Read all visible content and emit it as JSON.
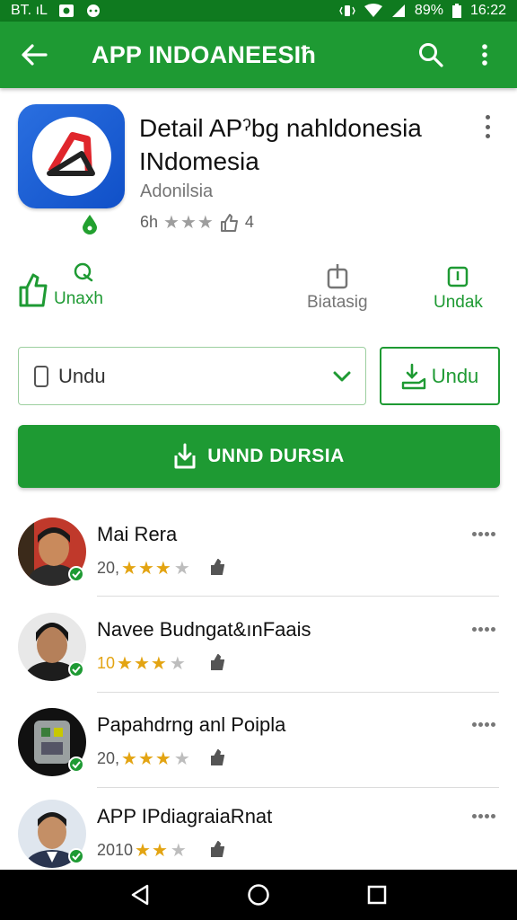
{
  "status_bar": {
    "carrier": "BT. ıL",
    "battery": "89%",
    "time": "16:22"
  },
  "app_bar": {
    "title": "APP INDOANEESIħ"
  },
  "app": {
    "title": "Detail APˀbg nahldonesia INdomesia",
    "developer": "Adonilsia",
    "rating_count": "6h",
    "download_count": "4"
  },
  "actions": {
    "share_label": "Unaxh",
    "middle_label": "Biatasig",
    "right_label": "Undak"
  },
  "dropdown": {
    "value": "Undu"
  },
  "outline_button": {
    "label": "Undu"
  },
  "primary_button": {
    "label": "UNND DURSIA"
  },
  "reviews": [
    {
      "name": "Mai Rera",
      "count": "20,",
      "stars": 3
    },
    {
      "name": "Navee Budngat&ınFaais",
      "count": "10",
      "stars": 3
    },
    {
      "name": "Papahdrng anl Poipla",
      "count": "20,",
      "stars": 3
    },
    {
      "name": "APP IPdiagraiaRnat",
      "count": "2010",
      "stars": 2
    }
  ],
  "colors": {
    "brand_green": "#1e9a33",
    "status_green": "#0f7a1f",
    "star_gold": "#e3a412"
  }
}
